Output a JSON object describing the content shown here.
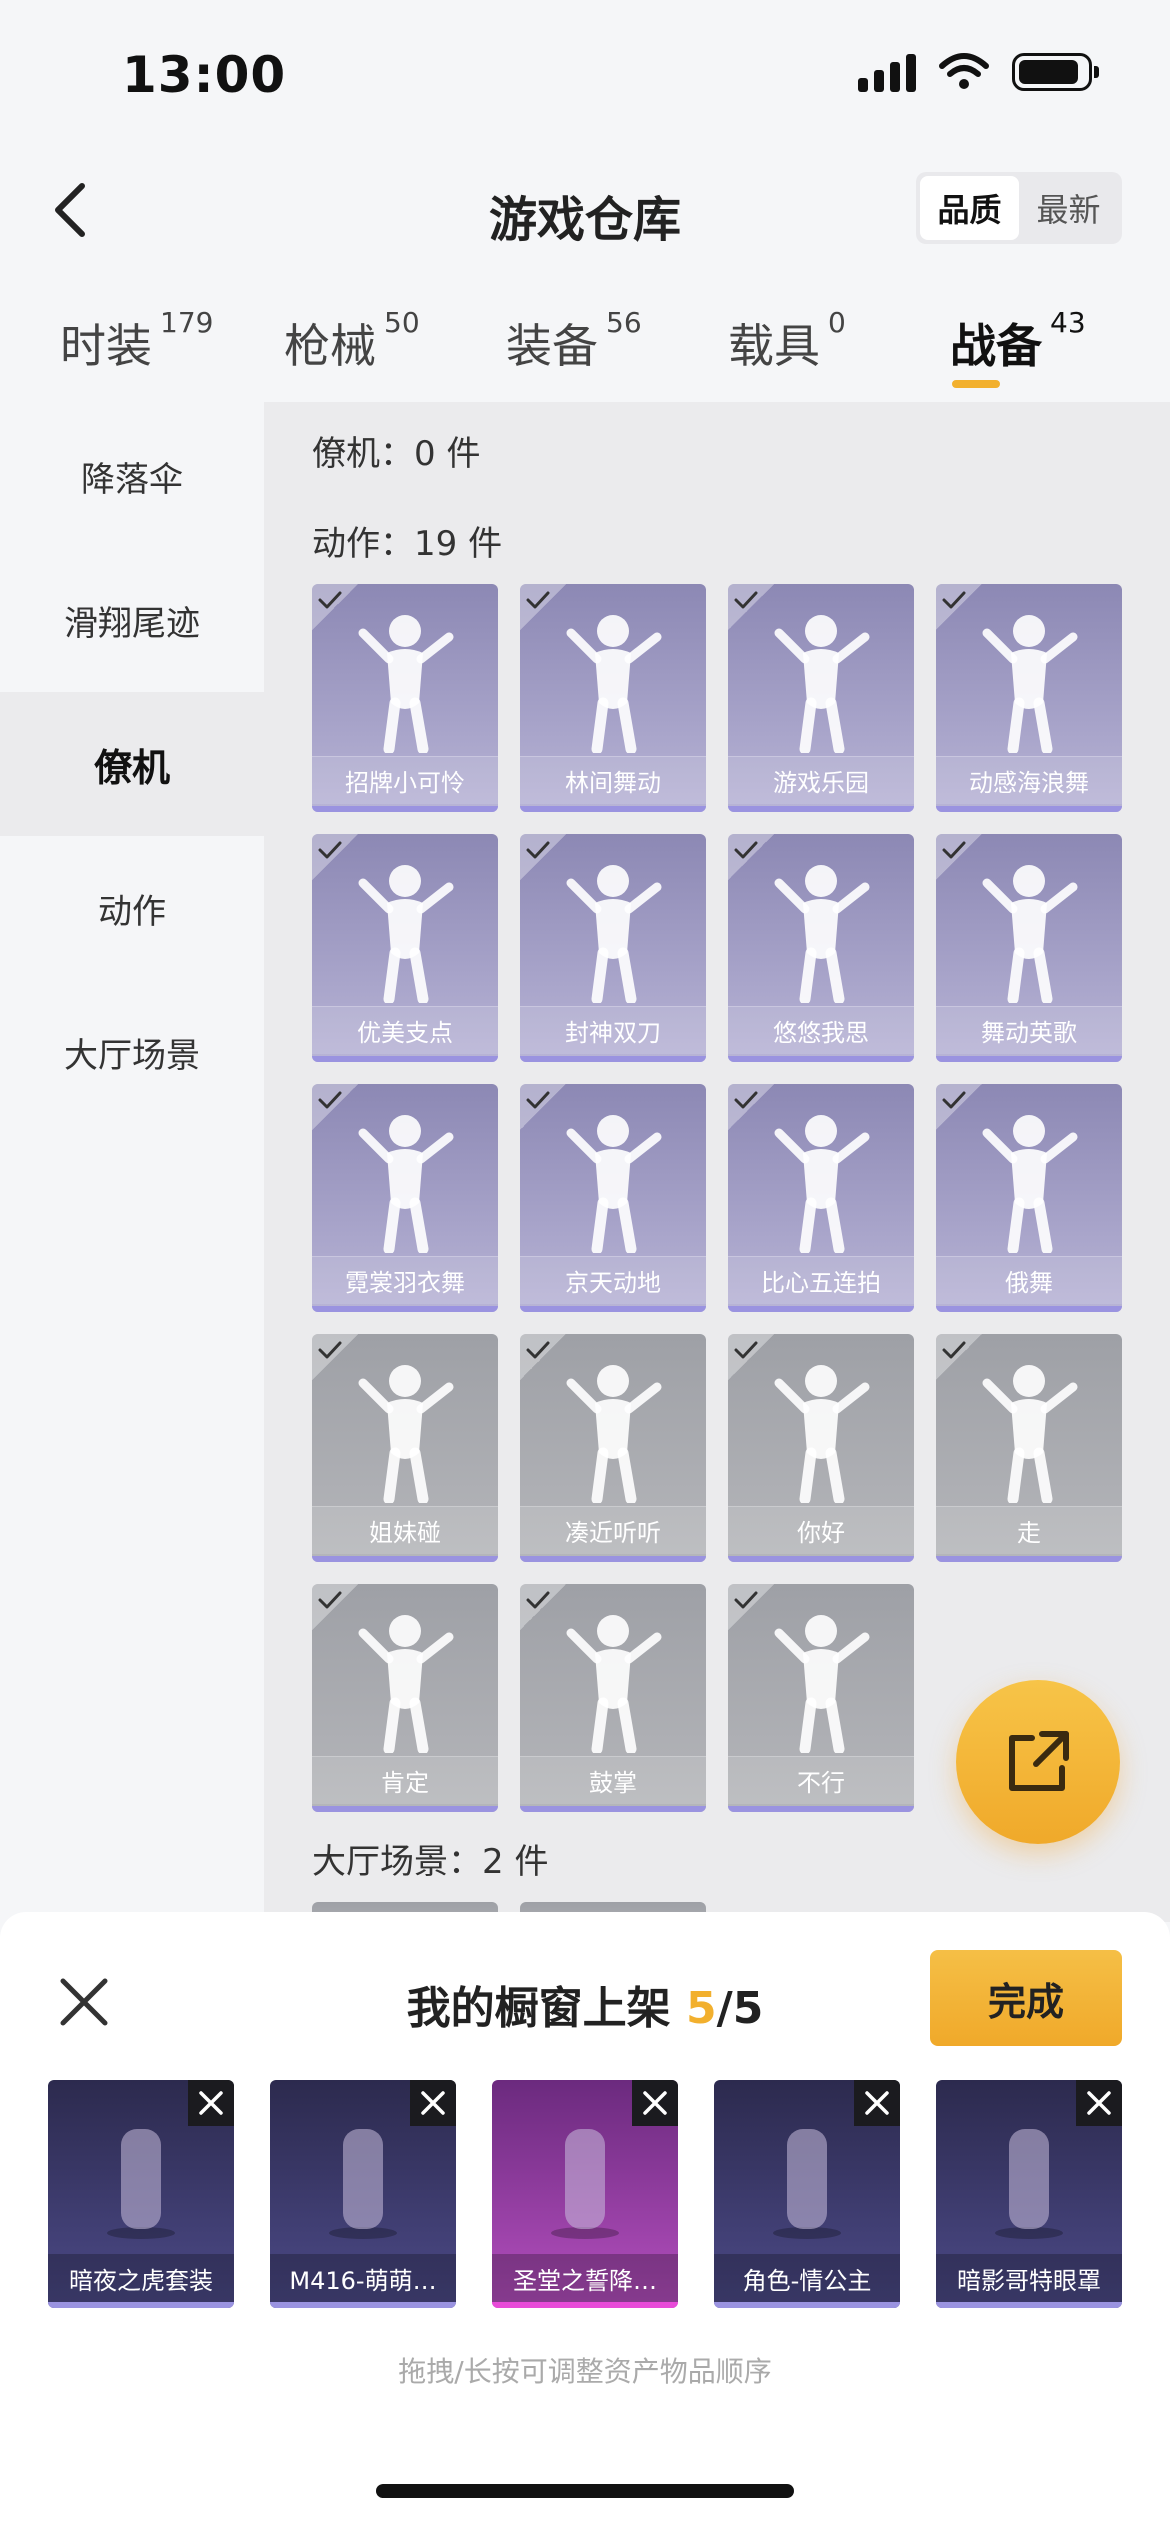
{
  "status_bar": {
    "time": "13:00"
  },
  "header": {
    "title": "游戏仓库",
    "sort_options": [
      "品质",
      "最新"
    ],
    "active_sort": "品质"
  },
  "tabs": [
    {
      "label": "时装",
      "count": "179"
    },
    {
      "label": "枪械",
      "count": "50"
    },
    {
      "label": "装备",
      "count": "56"
    },
    {
      "label": "载具",
      "count": "0"
    },
    {
      "label": "战备",
      "count": "43"
    }
  ],
  "active_tab": "战备",
  "sidebar": {
    "items": [
      {
        "label": "降落伞"
      },
      {
        "label": "滑翔尾迹"
      },
      {
        "label": "僚机"
      },
      {
        "label": "动作"
      },
      {
        "label": "大厅场景"
      }
    ],
    "active": "僚机"
  },
  "sections": {
    "wingman": "僚机：0 件",
    "actions": "动作：19 件",
    "lobby": "大厅场景：2 件"
  },
  "actions": [
    {
      "name": "招牌小可怜",
      "style": "purple"
    },
    {
      "name": "林间舞动",
      "style": "purple"
    },
    {
      "name": "游戏乐园",
      "style": "purple"
    },
    {
      "name": "动感海浪舞",
      "style": "purple"
    },
    {
      "name": "优美支点",
      "style": "purple"
    },
    {
      "name": "封神双刀",
      "style": "purple"
    },
    {
      "name": "悠悠我思",
      "style": "purple"
    },
    {
      "name": "舞动英歌",
      "style": "purple"
    },
    {
      "name": "霓裳羽衣舞",
      "style": "purple"
    },
    {
      "name": "京天动地",
      "style": "purple"
    },
    {
      "name": "比心五连拍",
      "style": "purple"
    },
    {
      "name": "俄舞",
      "style": "purple"
    },
    {
      "name": "姐妹碰",
      "style": "gray"
    },
    {
      "name": "凑近听听",
      "style": "gray"
    },
    {
      "name": "你好",
      "style": "gray"
    },
    {
      "name": "走",
      "style": "gray"
    },
    {
      "name": "肯定",
      "style": "gray"
    },
    {
      "name": "鼓掌",
      "style": "gray"
    },
    {
      "name": "不行",
      "style": "gray"
    }
  ],
  "showcase": {
    "title_prefix": "我的橱窗上架 ",
    "count": "5",
    "total": "/5",
    "done_label": "完成",
    "items": [
      {
        "name": "暗夜之虎套装",
        "style": "dark"
      },
      {
        "name": "M416-萌萌…",
        "style": "dark"
      },
      {
        "name": "圣堂之誓降…",
        "style": "pink"
      },
      {
        "name": "角色-情公主",
        "style": "dark"
      },
      {
        "name": "暗影哥特眼罩",
        "style": "dark"
      }
    ],
    "hint": "拖拽/长按可调整资产物品顺序"
  },
  "colors": {
    "accent": "#f2b02e",
    "purple_tile": "#8c88b4",
    "gray_tile": "#9ea0a6"
  },
  "icons": [
    "back-arrow-icon",
    "signal-icon",
    "wifi-icon",
    "battery-icon",
    "checkmark-icon",
    "share-icon",
    "close-icon"
  ]
}
